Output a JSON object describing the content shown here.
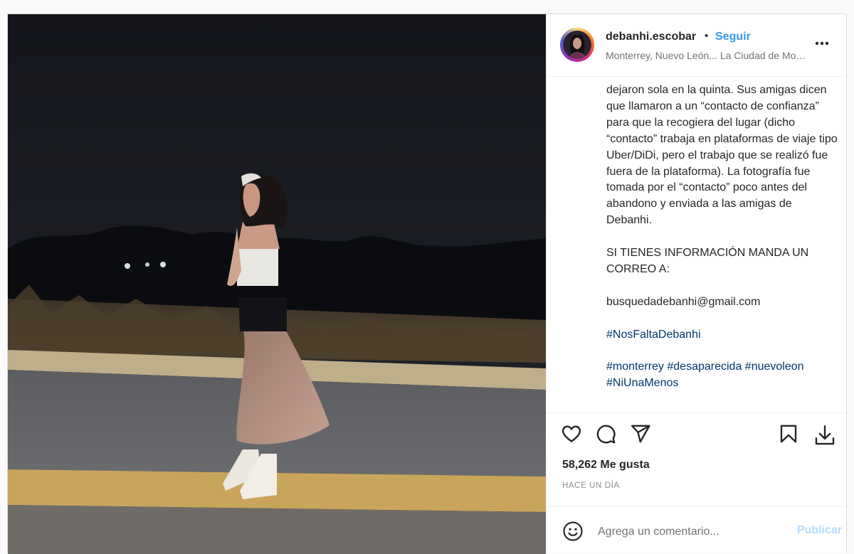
{
  "post": {
    "username": "debanhi.escobar",
    "separator": "•",
    "follow_label": "Seguir",
    "location": "Monterrey, Nuevo León... La Ciudad de Monterrey"
  },
  "caption": {
    "paragraph": "dejaron sola en la quinta. Sus amigas dicen que llamaron a un “contacto de confianza” para que la recogiera del lugar (dicho “contacto” trabaja en plataformas de viaje tipo Uber/DiDi, pero el trabajo que se realizó fue fuera de la plataforma). La fotografía fue tomada por el “contacto” poco antes del abandono y enviada a las amigas de Debanhi.",
    "info": "SI TIENES INFORMACIÓN MANDA UN CORREO A:",
    "email": "busquedadebanhi@gmail.com",
    "hashtag_main": "#NosFaltaDebanhi",
    "hashtags": [
      "#monterrey",
      "#desaparecida",
      "#nuevoleon",
      "#NiUnaMenos"
    ]
  },
  "actions": {
    "like_icon": "heart-icon",
    "comment_icon": "comment-icon",
    "share_icon": "paper-plane-icon",
    "save_icon": "bookmark-icon",
    "download_icon": "download-icon"
  },
  "stats": {
    "likes": "58,262 Me gusta",
    "time": "HACE UN DÍA"
  },
  "comment_box": {
    "placeholder": "Agrega un comentario...",
    "publish_label": "Publicar",
    "emoji_icon": "smiley-icon"
  },
  "colors": {
    "link": "#3897f0",
    "hashtag": "#00376b",
    "publish_disabled": "#b3dbff",
    "muted": "#8e8e8e"
  }
}
